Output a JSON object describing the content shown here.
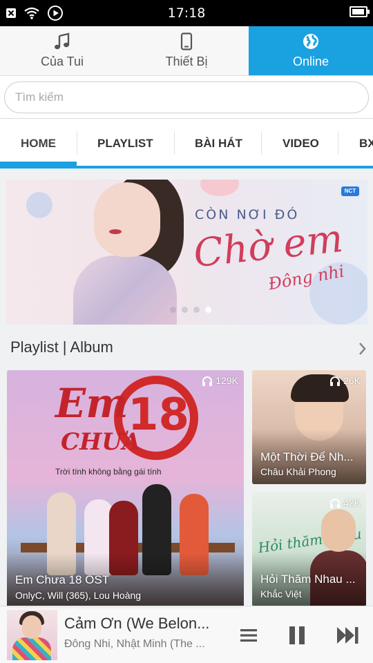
{
  "status_bar": {
    "time": "17:18",
    "battery_level": 0.75
  },
  "top_tabs": [
    {
      "label": "Của Tui",
      "icon": "music-note-icon",
      "active": false
    },
    {
      "label": "Thiết Bị",
      "icon": "phone-icon",
      "active": false
    },
    {
      "label": "Online",
      "icon": "globe-icon",
      "active": true
    }
  ],
  "search": {
    "placeholder": "Tìm kiếm"
  },
  "nav_tabs": [
    {
      "label": "HOME",
      "active": true
    },
    {
      "label": "PLAYLIST",
      "active": false
    },
    {
      "label": "BÀI HÁT",
      "active": false
    },
    {
      "label": "VIDEO",
      "active": false
    },
    {
      "label": "BX",
      "active": false
    }
  ],
  "banner": {
    "subtitle": "CÒN NƠI ĐÓ",
    "title": "Chờ em",
    "artist": "Đông nhi",
    "badge": "NCT",
    "page_count": 4,
    "active_page": 3
  },
  "section": {
    "title": "Playlist | Album",
    "more_icon": "chevron-right-icon"
  },
  "cards": [
    {
      "title": "Em Chưa 18 OST",
      "artist": "OnlyC, Will (365), Lou Hoàng",
      "listens": "129K",
      "art_logo": "Em",
      "art_logo2": "CHƯA",
      "art_number": "18",
      "art_slogan": "Trời tính không bằng gái tính"
    },
    {
      "title": "Một Thời Để Nh...",
      "artist": "Châu Khải Phong",
      "listens": "26K"
    },
    {
      "title": "Hỏi Thăm Nhau ...",
      "artist": "Khắc Việt",
      "listens": "42K",
      "art_script": "Hỏi thăm nhau"
    }
  ],
  "player": {
    "title": "Cảm Ơn (We Belon...",
    "artist": "Đông Nhi, Nhật Minh (The ...",
    "controls": [
      "playlist-icon",
      "pause-icon",
      "next-icon"
    ]
  },
  "colors": {
    "accent": "#1aa1e0",
    "banner_title": "#d13d5c"
  }
}
